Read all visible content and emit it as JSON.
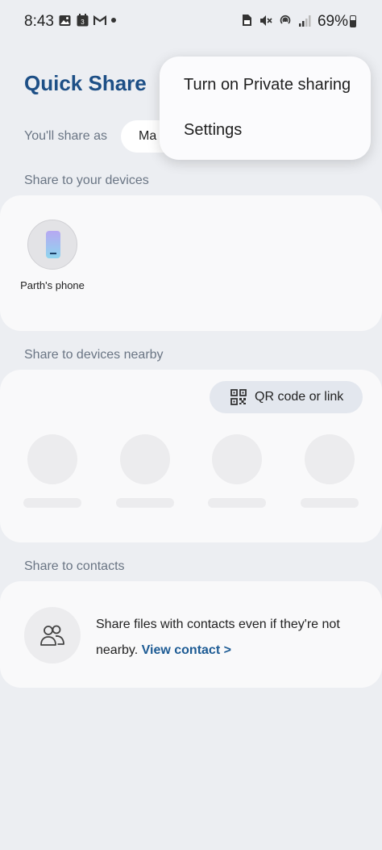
{
  "status_bar": {
    "time": "8:43",
    "calendar_day": "3",
    "battery": "69%",
    "left_icons": [
      "image-icon",
      "calendar-icon",
      "gmail-icon",
      "notification-dot-icon"
    ],
    "right_icons": [
      "sim-icon",
      "mute-icon",
      "hotspot-icon",
      "signal-icon",
      "battery-icon"
    ]
  },
  "header": {
    "title": "Quick Share",
    "share_as_label": "You'll share as",
    "share_as_value": "Ma"
  },
  "popup_menu": {
    "items": [
      "Turn on Private sharing",
      "Settings"
    ]
  },
  "sections": {
    "your_devices": {
      "label": "Share to your devices",
      "devices": [
        {
          "name": "Parth's phone",
          "icon": "phone-icon"
        }
      ]
    },
    "nearby": {
      "label": "Share to devices nearby",
      "qr_button": "QR code or link"
    },
    "contacts": {
      "label": "Share to contacts",
      "text": "Share files with contacts even if they're not nearby.",
      "link": "View contact >"
    }
  },
  "colors": {
    "background": "#eceef2",
    "title": "#1d4f86",
    "link": "#1d5b94",
    "card": "#f9f9fa"
  }
}
